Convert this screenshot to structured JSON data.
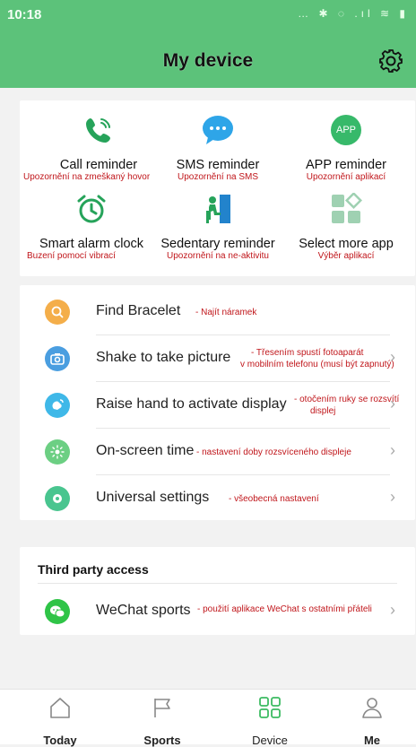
{
  "status_bar": {
    "time": "10:18",
    "icons": "… ✱ ◌ .ıl ≋ ▮"
  },
  "header": {
    "title": "My device"
  },
  "reminders": [
    {
      "label": "Call reminder",
      "note": "Upozornění na zmeškaný hovor",
      "icon": "phone-icon"
    },
    {
      "label": "SMS reminder",
      "note": "Upozornění na SMS",
      "icon": "sms-bubble-icon"
    },
    {
      "label": "APP reminder",
      "note": "Upozornění aplikací",
      "icon": "app-icon",
      "icon_text": "APP"
    },
    {
      "label": "Smart alarm clock",
      "note": "Buzení pomocí vibrací",
      "icon": "alarm-clock-icon"
    },
    {
      "label": "Sedentary reminder",
      "note": "Upozornění na ne-aktivitu",
      "icon": "sedentary-icon"
    },
    {
      "label": "Select more app",
      "note": "Výběr aplikací",
      "icon": "more-apps-icon"
    }
  ],
  "settings": [
    {
      "label": "Find Bracelet",
      "note": "- Najít náramek",
      "icon": "search-icon",
      "color": "#f4ae4a"
    },
    {
      "label": "Shake to take picture",
      "note": "- Třesením spustí fotoaparát",
      "note2": "v mobilním telefonu (musí být zapnutý)",
      "icon": "camera-icon",
      "color": "#4a9ee0"
    },
    {
      "label": "Raise hand to activate display",
      "note": "- otočením ruky se rozsvítí",
      "note2": "displej",
      "icon": "raise-hand-icon",
      "color": "#3fb8e8"
    },
    {
      "label": "On-screen time",
      "note": "- nastavení doby rozsvíceného displeje",
      "icon": "sun-icon",
      "color": "#6ccf83"
    },
    {
      "label": "Universal settings",
      "note": "- všeobecná nastavení",
      "icon": "gear-icon",
      "color": "#49c58f"
    }
  ],
  "third_party": {
    "title": "Third party access",
    "items": [
      {
        "label": "WeChat sports",
        "note": "- použití aplikace WeChat s ostatními přáteli",
        "icon": "wechat-icon",
        "color": "#2fc447"
      }
    ]
  },
  "tabs": [
    {
      "label": "Today",
      "icon": "home-icon",
      "active": false
    },
    {
      "label": "Sports",
      "icon": "flag-icon",
      "active": false
    },
    {
      "label": "Device",
      "icon": "device-grid-icon",
      "active": true
    },
    {
      "label": "Me",
      "icon": "person-icon",
      "active": false
    }
  ],
  "colors": {
    "accent": "#5cc27a",
    "note_red": "#c0161b"
  }
}
